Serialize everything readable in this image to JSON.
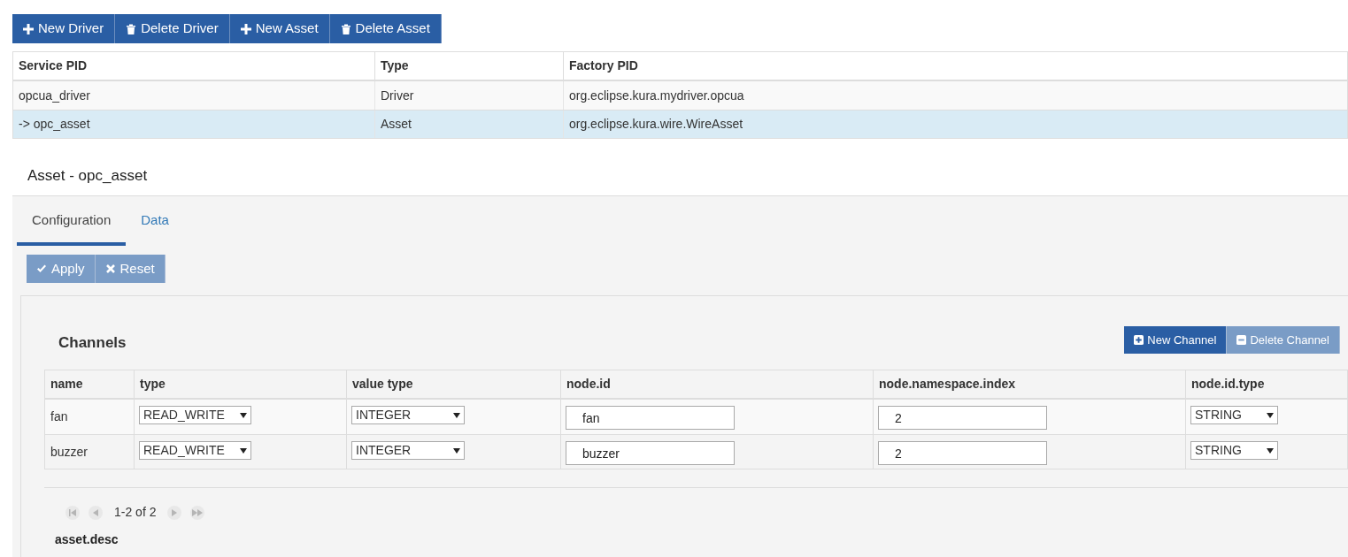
{
  "toolbar": [
    {
      "label": "New Driver",
      "kind": "plus"
    },
    {
      "label": "Delete Driver",
      "kind": "trash"
    },
    {
      "label": "New Asset",
      "kind": "plus"
    },
    {
      "label": "Delete Asset",
      "kind": "trash"
    }
  ],
  "services": {
    "columns": [
      "Service PID",
      "Type",
      "Factory PID"
    ],
    "rows": [
      {
        "cells": [
          "opcua_driver",
          "Driver",
          "org.eclipse.kura.mydriver.opcua"
        ],
        "selected": false
      },
      {
        "cells": [
          "-> opc_asset",
          "Asset",
          "org.eclipse.kura.wire.WireAsset"
        ],
        "selected": true
      }
    ]
  },
  "asset_title": "Asset - opc_asset",
  "tabs": [
    {
      "label": "Configuration",
      "selected": true
    },
    {
      "label": "Data",
      "selected": false
    }
  ],
  "actions": [
    {
      "label": "Apply",
      "kind": "check",
      "disabled": true
    },
    {
      "label": "Reset",
      "kind": "x",
      "disabled": true
    }
  ],
  "channels": {
    "title": "Channels",
    "buttons": [
      {
        "label": "New Channel",
        "kind": "plus",
        "disabled": false
      },
      {
        "label": "Delete Channel",
        "kind": "minus",
        "disabled": true
      }
    ],
    "columns": [
      "name",
      "type",
      "value type",
      "node.id",
      "node.namespace.index",
      "node.id.type"
    ],
    "rows": [
      {
        "name": "fan",
        "type": "READ_WRITE",
        "value_type": "INTEGER",
        "node_id": "fan",
        "namespace_index": "2",
        "node_id_type": "STRING"
      },
      {
        "name": "buzzer",
        "type": "READ_WRITE",
        "value_type": "INTEGER",
        "node_id": "buzzer",
        "namespace_index": "2",
        "node_id_type": "STRING"
      }
    ],
    "pager": {
      "text": "1-2 of 2",
      "buttons": [
        {
          "kind": "first",
          "disabled": true
        },
        {
          "kind": "prev",
          "disabled": true
        },
        {
          "kind": "next",
          "disabled": true
        },
        {
          "kind": "last",
          "disabled": true
        }
      ]
    }
  },
  "next_field_label": "asset.desc"
}
